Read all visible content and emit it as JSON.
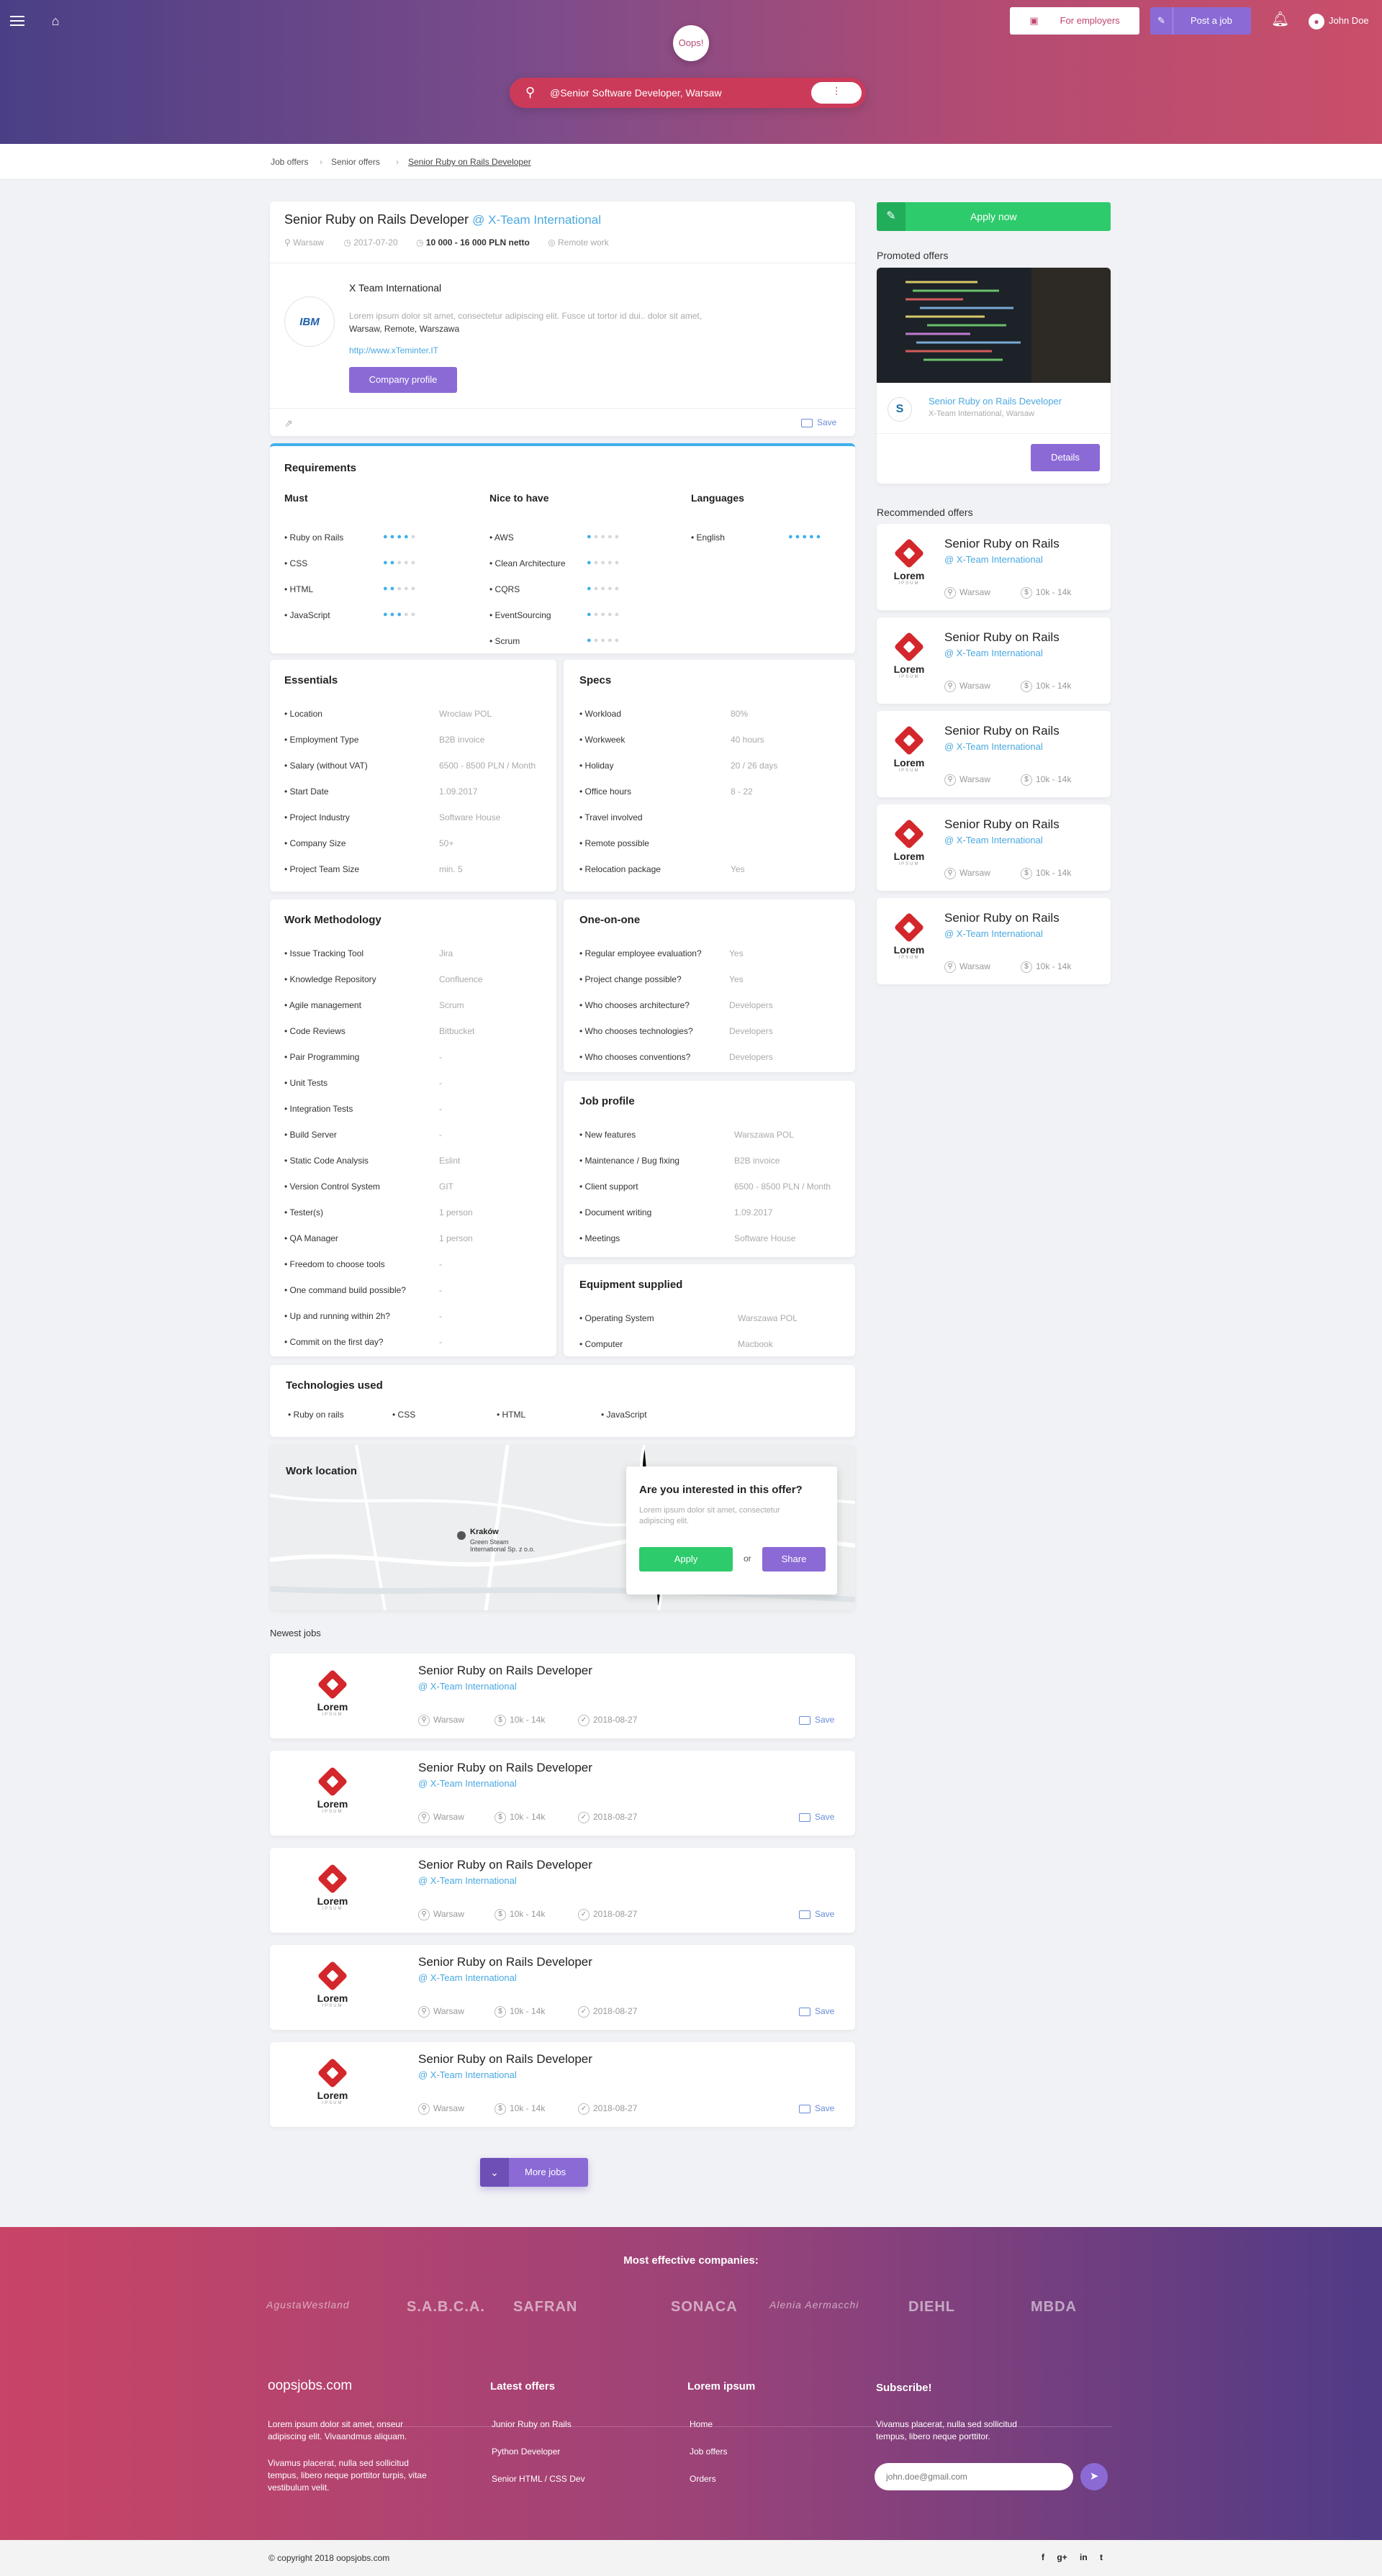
{
  "header": {
    "logo": "Oops!",
    "for_employers": "For employers",
    "post_job": "Post a job",
    "user": "John Doe",
    "search_value": "@Senior Software Developer, Warsaw"
  },
  "breadcrumb": [
    "Job offers",
    "Senior offers",
    "Senior Ruby on Rails Developer"
  ],
  "job": {
    "title": "Senior Ruby on Rails Developer",
    "company_at": "@ X-Team International",
    "location": "Warsaw",
    "date": "2017-07-20",
    "salary": "10 000 - 16 000 PLN netto",
    "remote": "Remote work",
    "company_name": "X Team International",
    "company_logo": "IBM",
    "desc": "Lorem ipsum dolor sit amet, consectetur adipiscing elit. Fusce ut tortor id dui.. dolor sit amet,",
    "addr": "Warsaw, Remote, Warszawa",
    "url": "http://www.xTeminter.IT",
    "profile_btn": "Company profile",
    "save": "Save"
  },
  "requirements": {
    "title": "Requirements",
    "must_title": "Must",
    "nice_title": "Nice to have",
    "lang_title": "Languages",
    "must": [
      {
        "name": "Ruby on Rails",
        "level": 4
      },
      {
        "name": "CSS",
        "level": 2
      },
      {
        "name": "HTML",
        "level": 2
      },
      {
        "name": "JavaScript",
        "level": 3
      }
    ],
    "nice": [
      {
        "name": "AWS",
        "level": 1
      },
      {
        "name": "Clean Architecture",
        "level": 1
      },
      {
        "name": "CQRS",
        "level": 1
      },
      {
        "name": "EventSourcing",
        "level": 1
      },
      {
        "name": "Scrum",
        "level": 1
      }
    ],
    "languages": [
      {
        "name": "English",
        "level": 5
      }
    ]
  },
  "essentials": {
    "title": "Essentials",
    "rows": [
      [
        "Location",
        "Wroclaw POL"
      ],
      [
        "Employment Type",
        "B2B invoice"
      ],
      [
        "Salary (without VAT)",
        "6500 - 8500 PLN / Month"
      ],
      [
        "Start Date",
        "1.09.2017"
      ],
      [
        "Project Industry",
        "Software House"
      ],
      [
        "Company Size",
        "50+"
      ],
      [
        "Project Team Size",
        "min. 5"
      ]
    ]
  },
  "specs": {
    "title": "Specs",
    "rows": [
      [
        "Workload",
        "80%"
      ],
      [
        "Workweek",
        "40 hours"
      ],
      [
        "Holiday",
        "20 / 26 days"
      ],
      [
        "Office hours",
        "8 - 22"
      ],
      [
        "Travel involved",
        ""
      ],
      [
        "Remote possible",
        ""
      ],
      [
        "Relocation package",
        "Yes"
      ]
    ]
  },
  "methodology": {
    "title": "Work Methodology",
    "rows": [
      [
        "Issue Tracking Tool",
        "Jira"
      ],
      [
        "Knowledge Repository",
        "Confluence"
      ],
      [
        "Agile management",
        "Scrum"
      ],
      [
        "Code Reviews",
        "Bitbucket"
      ],
      [
        "Pair Programming",
        "-"
      ],
      [
        "Unit Tests",
        "-"
      ],
      [
        "Integration Tests",
        "-"
      ],
      [
        "Build Server",
        "-"
      ],
      [
        "Static Code Analysis",
        "Eslint"
      ],
      [
        "Version Control System",
        "GIT"
      ],
      [
        "Tester(s)",
        "1 person"
      ],
      [
        "QA Manager",
        "1 person"
      ],
      [
        "Freedom to choose tools",
        "-"
      ],
      [
        "One command build possible?",
        "-"
      ],
      [
        "Up and running within 2h?",
        "-"
      ],
      [
        "Commit on the first day?",
        "-"
      ]
    ]
  },
  "oneonone": {
    "title": "One-on-one",
    "rows": [
      [
        "Regular employee evaluation?",
        "Yes"
      ],
      [
        "Project change possible?",
        "Yes"
      ],
      [
        "Who chooses architecture?",
        "Developers"
      ],
      [
        "Who chooses technologies?",
        "Developers"
      ],
      [
        "Who chooses conventions?",
        "Developers"
      ]
    ]
  },
  "jobprofile": {
    "title": "Job profile",
    "rows": [
      [
        "New features",
        "Warszawa POL"
      ],
      [
        "Maintenance / Bug fixing",
        "B2B invoice"
      ],
      [
        "Client support",
        "6500 - 8500 PLN / Month"
      ],
      [
        "Document writing",
        "1.09.2017"
      ],
      [
        "Meetings",
        "Software House"
      ]
    ]
  },
  "equipment": {
    "title": "Equipment supplied",
    "rows": [
      [
        "Operating System",
        "Warszawa POL"
      ],
      [
        "Computer",
        "Macbook"
      ]
    ]
  },
  "technologies": {
    "title": "Technologies used",
    "items": [
      "Ruby on rails",
      "CSS",
      "HTML",
      "JavaScript"
    ]
  },
  "location": {
    "title": "Work location",
    "map_city": "Kraków",
    "map_place": "Green Steam International Sp. z o.o.",
    "interest_title": "Are you interested in this offer?",
    "interest_text": "Lorem ipsum dolor sit amet, consectetur adipiscing elit.",
    "apply": "Apply",
    "or": "or",
    "share": "Share"
  },
  "sidebar": {
    "apply_now": "Apply now",
    "promoted_title": "Promoted offers",
    "promoted_job": "Senior Ruby on Rails Developer",
    "promoted_company": "X-Team International, Warsaw",
    "details": "Details",
    "recommended_title": "Recommended offers",
    "rec_job": "Senior Ruby on Rails",
    "rec_company": "@ X-Team International",
    "rec_loc": "Warsaw",
    "rec_sal": "10k - 14k",
    "rec_count": 5
  },
  "newest": {
    "title": "Newest jobs",
    "job": "Senior Ruby on Rails Developer",
    "company": "@ X-Team International",
    "loc": "Warsaw",
    "sal": "10k - 14k",
    "date": "2018-08-27",
    "save": "Save",
    "more": "More jobs"
  },
  "lorem_logo": {
    "text": "Lorem",
    "sub": "IPSUM"
  },
  "footer": {
    "companies_title": "Most effective companies:",
    "companies": [
      "AgustaWestland",
      "S.A.B.C.A.",
      "SAFRAN",
      "SONACA",
      "Alenia Aermacchi",
      "DIEHL",
      "MBDA"
    ],
    "brand": "oopsjobs.com",
    "about1": "Lorem ipsum dolor sit amet, onseur adipiscing elit. Vivaandmus aliquam.",
    "about2": "Vivamus placerat, nulla sed sollicitud tempus, libero neque porttitor turpis, vitae vestibulum velit.",
    "latest_title": "Latest offers",
    "latest": [
      "Junior Ruby on Rails",
      "Python Developer",
      "Senior HTML / CSS Dev"
    ],
    "lorem_title": "Lorem ipsum",
    "links": [
      "Home",
      "Job offers",
      "Orders"
    ],
    "subscribe_title": "Subscribe!",
    "subscribe_text": "Vivamus placerat, nulla sed sollicitud tempus, libero neque porttitor.",
    "email": "john.doe@gmail.com",
    "copyright": "© copyright 2018 oopsjobs.com",
    "social": [
      "f",
      "g+",
      "in",
      "t"
    ]
  },
  "colors": {
    "accent": "#8b6ad6",
    "apply": "#2dcb6b",
    "link": "#4ba8e0",
    "brand": "#c2456c"
  }
}
